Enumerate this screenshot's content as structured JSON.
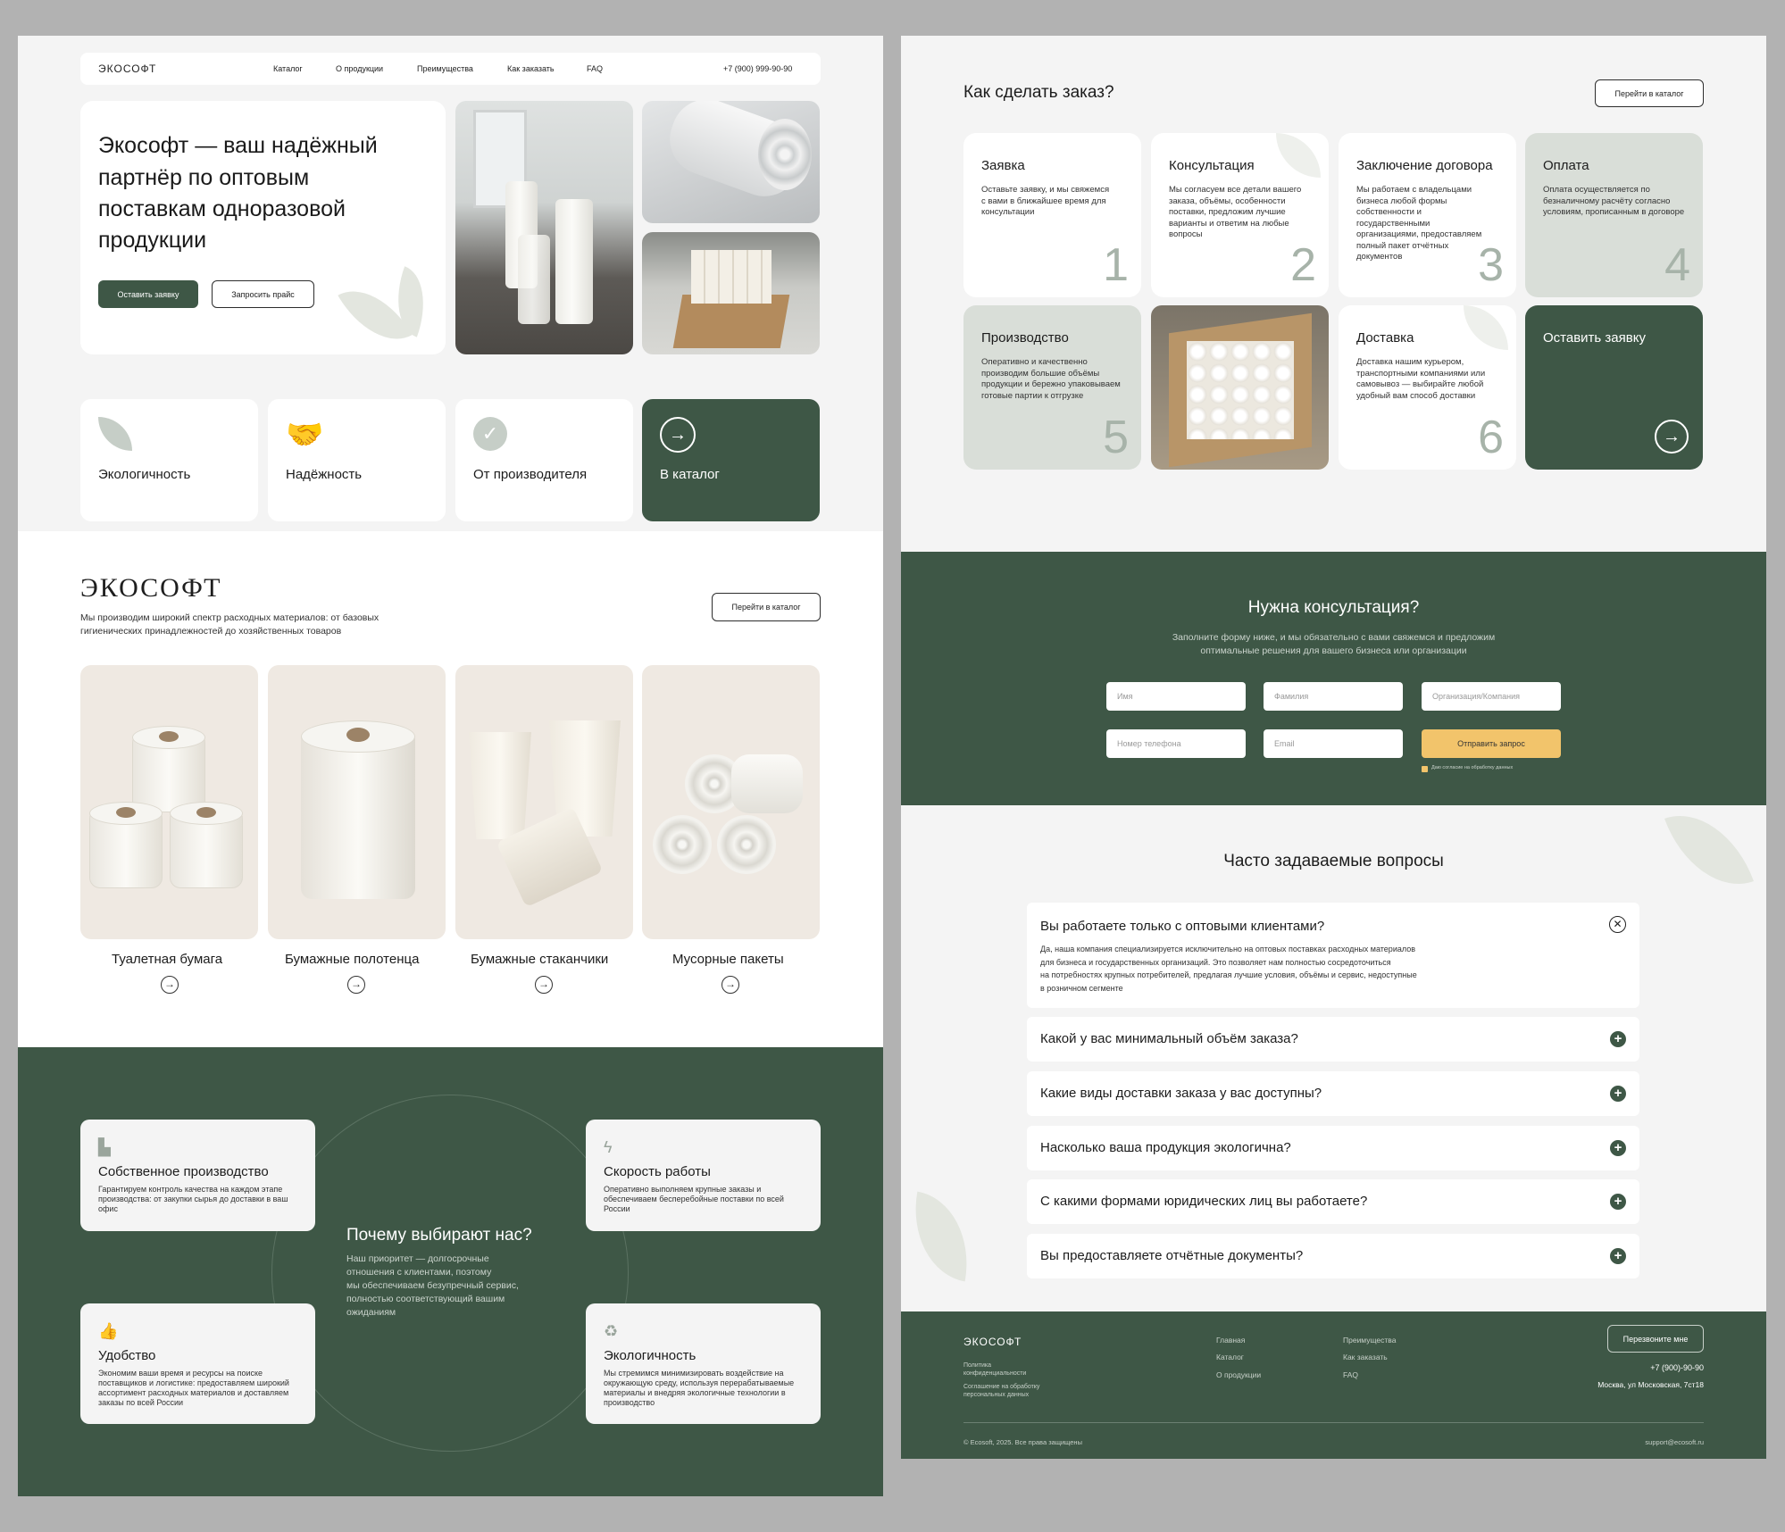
{
  "nav": {
    "logo": "ЭКОСОФТ",
    "links": [
      "Каталог",
      "О продукции",
      "Преимущества",
      "Как заказать",
      "FAQ"
    ],
    "phone": "+7 (900) 999-90-90"
  },
  "hero": {
    "title_lines": [
      "Экософт — ваш надёжный",
      "партнёр по оптовым",
      "поставкам одноразовой",
      "продукции"
    ],
    "btn_request": "Оставить заявку",
    "btn_price": "Запросить прайс"
  },
  "features": [
    "Экологичность",
    "Надёжность",
    "От производителя",
    "В каталог"
  ],
  "about": {
    "logo": "ЭКОСОФТ",
    "text_line1": "Мы производим широкий спектр расходных материалов: от базовых",
    "text_line2": "гигиенических принадлежностей до хозяйственных товаров",
    "catalog_btn": "Перейти в каталог"
  },
  "products": [
    "Туалетная бумага",
    "Бумажные полотенца",
    "Бумажные стаканчики",
    "Мусорные пакеты"
  ],
  "why": {
    "title": "Почему выбирают нас?",
    "text_lines": [
      "Наш приоритет — долгосрочные",
      "отношения с клиентами, поэтому",
      "мы обеспечиваем безупречный сервис,",
      "полностью соответствующий вашим",
      "ожиданиям"
    ],
    "cards": [
      {
        "title": "Собственное производство",
        "text": "Гарантируем контроль качества на каждом этапе производства: от закупки сырья до доставки в ваш офис",
        "icon": "factory-icon"
      },
      {
        "title": "Скорость работы",
        "text": "Оперативно выполняем крупные заказы и обеспечиваем бесперебойные поставки по всей России",
        "icon": "lightning-icon"
      },
      {
        "title": "Удобство",
        "text": "Экономим ваши время и ресурсы на поиске поставщиков и логистике: предоставляем широкий ассортимент расходных материалов и доставляем заказы по всей России",
        "icon": "thumbs-up-icon"
      },
      {
        "title": "Экологичность",
        "text": "Мы стремимся минимизировать воздействие на окружающую среду, используя перерабатываемые материалы и внедряя экологичные технологии в производство",
        "icon": "recycle-icon"
      }
    ]
  },
  "order": {
    "title": "Как сделать заказ?",
    "catalog_btn": "Перейти в каталог",
    "steps": [
      {
        "title": "Заявка",
        "text": "Оставьте заявку, и мы свяжемся с вами в ближайшее время для консультации",
        "num": "1"
      },
      {
        "title": "Консультация",
        "text": "Мы согласуем все детали вашего заказа, объёмы, особенности поставки, предложим лучшие варианты и ответим на любые вопросы",
        "num": "2"
      },
      {
        "title": "Заключение договора",
        "text": "Мы работаем с владельцами бизнеса любой формы собственности и государственными организациями, предоставляем полный пакет отчётных документов",
        "num": "3"
      },
      {
        "title": "Оплата",
        "text": "Оплата осуществляется по безналичному расчёту согласно условиям, прописанным в договоре",
        "num": "4"
      },
      {
        "title": "Производство",
        "text": "Оперативно и качественно производим большие объёмы продукции и бережно упаковываем готовые партии к отгрузке",
        "num": "5"
      },
      {
        "title": "Доставка",
        "text": "Доставка нашим курьером, транспортными компаниями или самовывоз — выбирайте любой удобный вам способ доставки",
        "num": "6"
      }
    ],
    "cta": "Оставить заявку"
  },
  "consult": {
    "title": "Нужна консультация?",
    "sub_line1": "Заполните форму ниже, и мы обязательно с вами свяжемся и предложим",
    "sub_line2": "оптимальные решения для вашего бизнеса или организации",
    "placeholders": {
      "name": "Имя",
      "surname": "Фамилия",
      "org": "Организация/Компания",
      "phone": "Номер телефона",
      "email": "Email"
    },
    "submit": "Отправить запрос",
    "consent": "Даю согласие на обработку данных"
  },
  "faq": {
    "title": "Часто задаваемые вопросы",
    "open_q": "Вы работаете только с оптовыми клиентами?",
    "open_a": [
      "Да, наша компания специализируется исключительно на оптовых поставках расходных материалов",
      "для бизнеса и государственных организаций. Это позволяет нам полностью сосредоточиться",
      "на потребностях крупных потребителей, предлагая лучшие условия, объёмы и сервис, недоступные",
      "в розничном сегменте"
    ],
    "items": [
      "Какой у вас минимальный объём заказа?",
      "Какие виды доставки заказа у вас доступны?",
      "Насколько ваша продукция экологична?",
      "С какими формами юридических лиц вы работаете?",
      "Вы предоставляете отчётные документы?"
    ]
  },
  "footer": {
    "logo": "ЭКОСОФТ",
    "policy": "Политика конфиденциальности",
    "consent": "Соглашение на обработку персональных данных",
    "col1": [
      "Главная",
      "Каталог",
      "О продукции"
    ],
    "col2": [
      "Преимущества",
      "Как заказать",
      "FAQ"
    ],
    "callback": "Перезвоните мне",
    "phone": "+7 (900)-90-90",
    "address": "Москва, ул Московская, 7ст18",
    "copyright": "© Ecosoft, 2025. Все права защищены",
    "email": "support@ecosoft.ru"
  },
  "colors": {
    "accent": "#3e5746",
    "light_green": "#d9ded8",
    "cta_yellow": "#f2c46b",
    "bg_light": "#f4f4f4"
  }
}
